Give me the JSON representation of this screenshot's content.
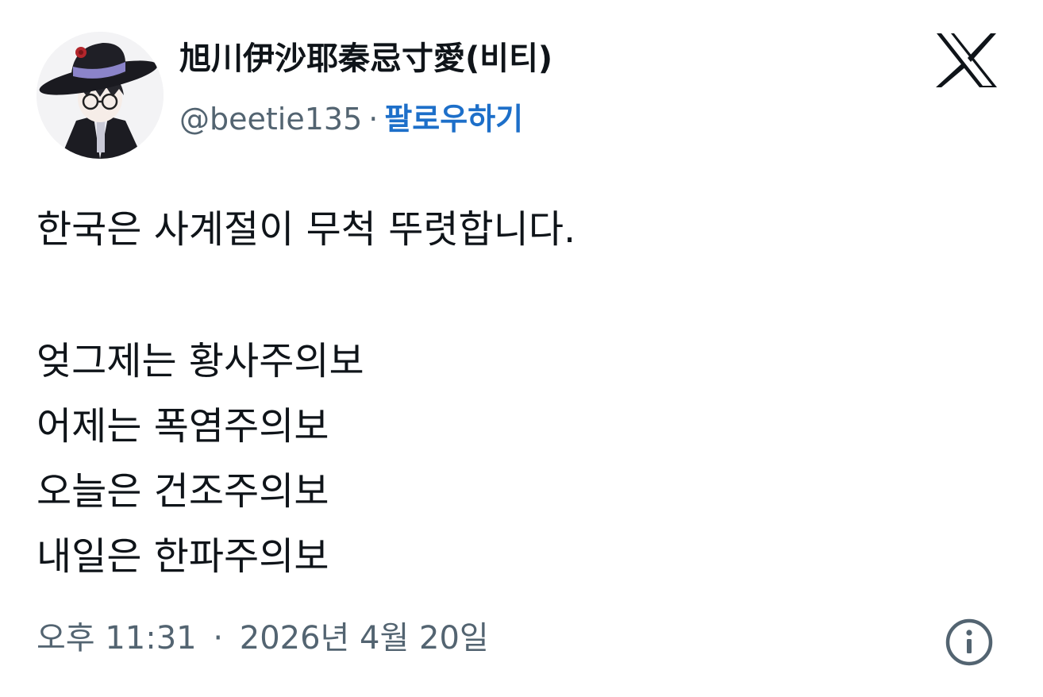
{
  "author": {
    "display_name": "旭川伊沙耶秦忌寸愛(비티)",
    "handle": "@beetie135",
    "separator": "·",
    "follow_label": "팔로우하기"
  },
  "tweet": {
    "lines": [
      "한국은 사계절이 무척 뚜렷합니다.",
      "",
      "엊그제는 황사주의보",
      "어제는 폭염주의보",
      "오늘은 건조주의보",
      "내일은 한파주의보"
    ]
  },
  "meta": {
    "time": "오후 11:31",
    "separator": "·",
    "date": "2026년 4월 20일"
  },
  "icons": {
    "logo": "x-logo-icon",
    "info": "info-icon"
  },
  "colors": {
    "text": "#0f1419",
    "secondary": "#536471",
    "link": "#1d6fc9"
  }
}
